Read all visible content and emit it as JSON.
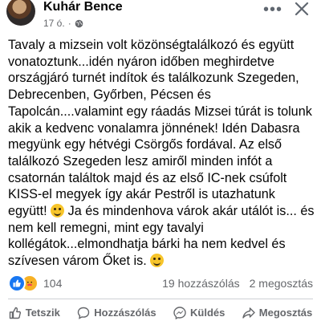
{
  "post": {
    "author": "Kuhár Bence",
    "time": "17 ó.",
    "separator": "·",
    "more_label": "•••",
    "paragraph_1": "Tavaly a mizsein volt közönségtalálkozó és együtt vonatoztunk...idén nyáron időben meghirdetve országjáró turnét indítok és találkozunk Szegeden, Debrecenben, Győrben, Pécsen és Tapolcán....valamint egy ráadás Mizsei túrát is tolunk akik a kedvenc vonalamra jönnének! Idén Dabasra megyünk egy hétvégi Csörgős fordával. Az első találkozó Szegeden lesz amiről minden infót a csatornán találtok majd és az első IC-nek csúfolt KISS-el megyek így akár Pestről is utazhatunk együtt!",
    "paragraph_2": " Ja és mindenhova várok akár utálót is... és nem kell remegni, mint egy tavalyi kollégátok...elmondhatja bárki ha nem kedvel és szívesen várom Őket is. "
  },
  "stats": {
    "reaction_count": "104",
    "comments": "19 hozzászólás",
    "shares": "2 megosztás"
  },
  "actions": [
    {
      "label": "Tetszik",
      "icon": "thumbs-up-icon"
    },
    {
      "label": "Hozzászólás",
      "icon": "comment-icon"
    },
    {
      "label": "Küldés",
      "icon": "messenger-icon"
    },
    {
      "label": "Megosztás",
      "icon": "share-icon"
    }
  ],
  "colors": {
    "text": "#050505",
    "secondary": "#65676b",
    "like_blue": "#1877f2",
    "emoji_yellow": "#f7c52b"
  }
}
